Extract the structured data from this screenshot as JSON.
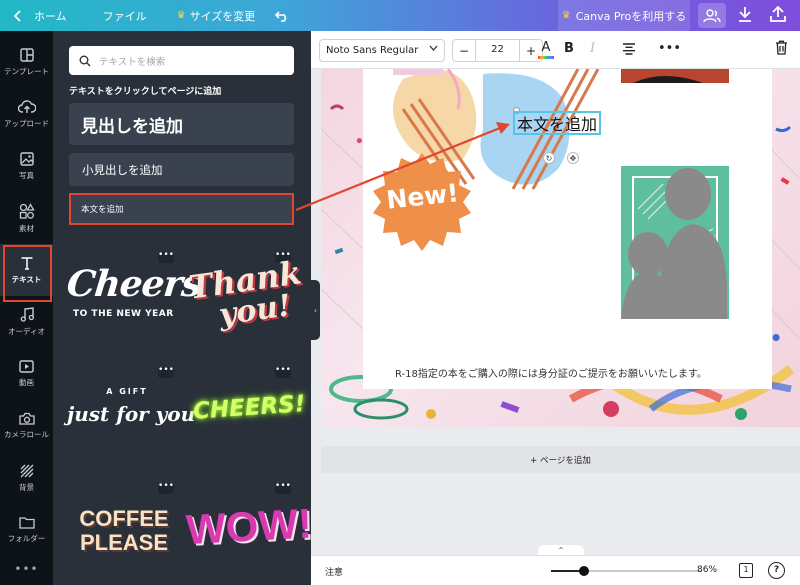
{
  "topbar": {
    "home": "ホーム",
    "file": "ファイル",
    "resize": "サイズを変更",
    "pro": "Canva Proを利用する"
  },
  "rail": {
    "items": [
      {
        "label": "テンプレート",
        "icon": "template-icon"
      },
      {
        "label": "アップロード",
        "icon": "upload-cloud-icon"
      },
      {
        "label": "写真",
        "icon": "photo-icon"
      },
      {
        "label": "素材",
        "icon": "elements-icon"
      },
      {
        "label": "テキスト",
        "icon": "text-icon"
      },
      {
        "label": "オーディオ",
        "icon": "music-icon"
      },
      {
        "label": "動画",
        "icon": "video-icon"
      },
      {
        "label": "カメラロール",
        "icon": "camera-icon"
      },
      {
        "label": "背景",
        "icon": "background-icon"
      },
      {
        "label": "フォルダー",
        "icon": "folder-icon"
      }
    ]
  },
  "panel": {
    "search_placeholder": "テキストを検索",
    "hint": "テキストをクリックしてページに追加",
    "heading": "見出しを追加",
    "subheading": "小見出しを追加",
    "body": "本文を追加",
    "tiles": {
      "cheers_main": "Cheers",
      "cheers_sub": "TO THE NEW YEAR",
      "thank": "Thank",
      "you": "you!",
      "gift_small": "A GIFT",
      "gift_script": "just for you",
      "cheers_neon": "CHEERS!",
      "coffee_1": "COFFEE",
      "coffee_2": "PLEASE",
      "wow": "WOW!"
    }
  },
  "toolbar": {
    "font": "Noto Sans Regular",
    "size": "22",
    "minus": "−",
    "plus": "+",
    "bold": "B",
    "italic": "I",
    "color_glyph": "A",
    "more": "•••"
  },
  "canvas": {
    "body_text": "本文を追加",
    "new_badge": "New!",
    "notice": "R-18指定の本をご購入の際には身分証のご提示をお願いいたします。",
    "add_page": "+ ページを追加"
  },
  "bottombar": {
    "notes": "注意",
    "zoom": "86%",
    "zoom_fraction": 0.22,
    "page": "1",
    "help": "?"
  },
  "colors": {
    "accent_annotation": "#e2462c",
    "selection": "#56c5e8",
    "new_badge": "#ee8f4a",
    "photo_frame": "#5fbea0"
  }
}
